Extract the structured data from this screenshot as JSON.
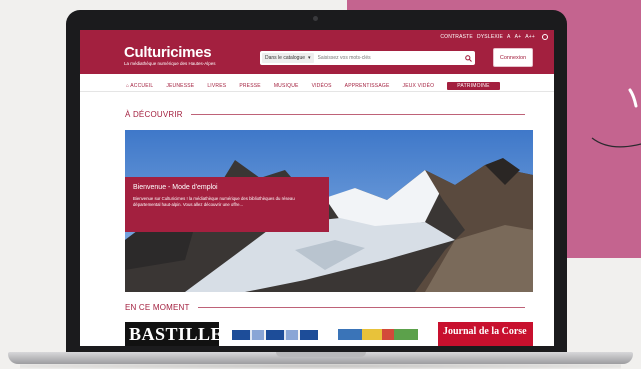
{
  "colors": {
    "brand": "#a3203f",
    "backdrop": "#c4648f"
  },
  "header": {
    "accessibility": [
      "CONTRASTE",
      "DYSLEXIE",
      "A",
      "A+",
      "A++"
    ],
    "logo_name": "Culturicimes",
    "logo_tagline": "La médiathèque numérique des Hautes-Alpes",
    "search_scope": "Dans le catalogue",
    "search_placeholder": "Saisissez vos mots-clés",
    "login_label": "Connexion"
  },
  "nav": {
    "items": [
      "ACCUEIL",
      "JEUNESSE",
      "LIVRES",
      "PRESSE",
      "MUSIQUE",
      "VIDÉOS",
      "APPRENTISSAGE",
      "JEUX VIDÉO"
    ],
    "patrimoine": "PATRIMOINE"
  },
  "discover": {
    "title": "À DÉCOUVRIR",
    "card_title": "Bienvenue - Mode d'emploi",
    "card_text": "Bienvenue sur Culturicimes ! la médiathèque numérique des bibliothèques du réseau départemental haut-alpin. Vous allez découvrir une offre..."
  },
  "moment": {
    "title": "EN CE MOMENT",
    "thumbs": [
      "BASTILLE",
      "Journal de la Corse"
    ]
  }
}
